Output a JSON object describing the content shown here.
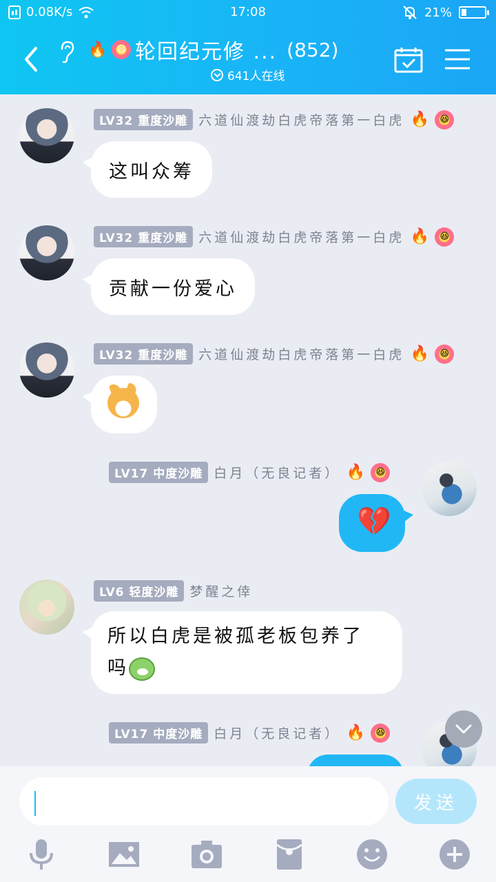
{
  "status_bar": {
    "net_speed": "0.08K/s",
    "time": "17:08",
    "battery": "21%",
    "battery_level": 0.21
  },
  "header": {
    "title": "轮回纪元修 ...",
    "member_count": "(852)",
    "online": "641人在线"
  },
  "messages": [
    {
      "badge": "LV32 重度沙雕",
      "nick": "六道仙渡劫白虎帝落第一白虎",
      "text": "这叫众筹"
    },
    {
      "badge": "LV32 重度沙雕",
      "nick": "六道仙渡劫白虎帝落第一白虎",
      "text": "贡献一份爱心"
    },
    {
      "badge": "LV32 重度沙雕",
      "nick": "六道仙渡劫白虎帝落第一白虎",
      "sticker": "dog-emoji"
    },
    {
      "badge": "LV17 中度沙雕",
      "nick": "白月（无良记者）",
      "sticker": "broken-heart-emoji"
    },
    {
      "badge": "LV6 轻度沙雕",
      "nick": "梦醒之倖",
      "text_line1": "所以白虎是被孤老板包养了",
      "text_line2": "吗"
    },
    {
      "badge": "LV17 中度沙雕",
      "nick": "白月（无良记者）"
    }
  ],
  "input": {
    "placeholder": "",
    "send_label": "发送"
  },
  "colors": {
    "header_gradient_start": "#0fc6f2",
    "header_gradient_end": "#1aa6f5",
    "my_bubble": "#21b7f5",
    "badge": "#a6acbf",
    "background": "#eaecf3"
  },
  "icons": [
    "back-icon",
    "ear-icon",
    "calendar-check-icon",
    "menu-icon",
    "mic-icon",
    "image-icon",
    "camera-icon",
    "red-packet-icon",
    "smile-icon",
    "plus-icon",
    "chevron-down-icon"
  ]
}
